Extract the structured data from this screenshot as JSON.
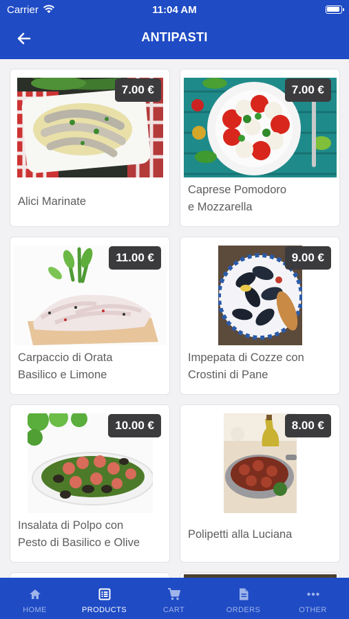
{
  "status_bar": {
    "carrier": "Carrier",
    "time": "11:04 AM"
  },
  "header": {
    "title": "ANTIPASTI"
  },
  "products": [
    {
      "name_line1": "Alici Marinate",
      "name_line2": "",
      "price": "7.00 €"
    },
    {
      "name_line1": "Caprese Pomodoro",
      "name_line2": "e Mozzarella",
      "price": "7.00 €"
    },
    {
      "name_line1": "Carpaccio di Orata",
      "name_line2": "Basilico e Limone",
      "price": "11.00 €"
    },
    {
      "name_line1": "Impepata di Cozze con",
      "name_line2": "Crostini di Pane",
      "price": "9.00 €"
    },
    {
      "name_line1": "Insalata di Polpo con",
      "name_line2": "Pesto di Basilico e Olive",
      "price": "10.00 €"
    },
    {
      "name_line1": "Polipetti alla Luciana",
      "name_line2": "",
      "price": "8.00 €"
    }
  ],
  "tabs": [
    {
      "label": "HOME",
      "icon": "home-icon"
    },
    {
      "label": "PRODUCTS",
      "icon": "products-icon"
    },
    {
      "label": "CART",
      "icon": "cart-icon"
    },
    {
      "label": "ORDERS",
      "icon": "orders-icon"
    },
    {
      "label": "OTHER",
      "icon": "more-icon"
    }
  ],
  "colors": {
    "brand_blue": "#1f4bc4",
    "price_badge": "#3b3b3d",
    "tab_inactive": "#9fb4ea",
    "tab_active": "#ffffff"
  }
}
